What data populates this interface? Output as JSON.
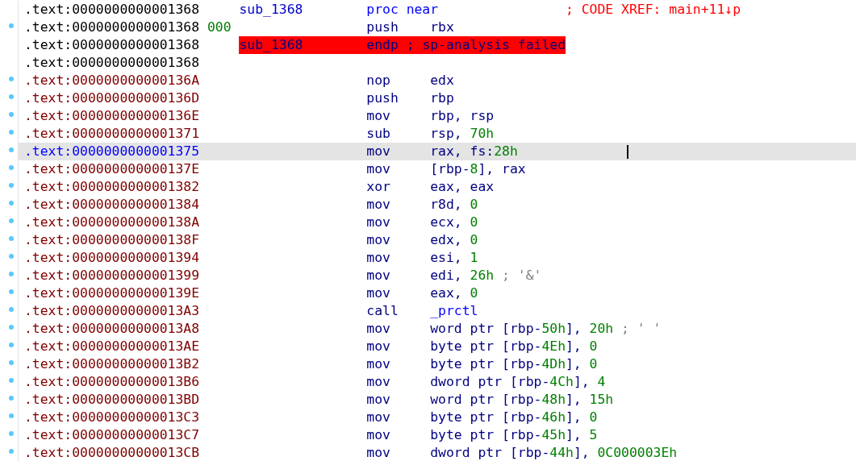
{
  "rows": [
    {
      "address": ".text:0000000000001368",
      "kind": "header",
      "dot": false,
      "selected": false,
      "error": false,
      "label": "sub_1368",
      "mnemonic": "proc near",
      "comment": {
        "text": "; CODE XREF: main+11↓p",
        "kind": "xref"
      }
    },
    {
      "address": ".text:0000000000001368",
      "kind": "header",
      "dot": true,
      "selected": false,
      "error": false,
      "stack": "000",
      "mnemonic": "push",
      "operands": [
        {
          "text": "rbx",
          "kind": "text"
        }
      ]
    },
    {
      "address": ".text:0000000000001368",
      "kind": "header",
      "dot": false,
      "selected": false,
      "error": true,
      "label": "sub_1368",
      "mnemonic": "endp",
      "comment": {
        "text": "; sp-analysis failed",
        "kind": "plain"
      }
    },
    {
      "address": ".text:0000000000001368",
      "kind": "header",
      "dot": false,
      "selected": false,
      "error": false
    },
    {
      "address": ".text:000000000000136A",
      "kind": "code",
      "dot": true,
      "selected": false,
      "error": false,
      "mnemonic": "nop",
      "operands": [
        {
          "text": "edx",
          "kind": "text"
        }
      ]
    },
    {
      "address": ".text:000000000000136D",
      "kind": "code",
      "dot": true,
      "selected": false,
      "error": false,
      "mnemonic": "push",
      "operands": [
        {
          "text": "rbp",
          "kind": "text"
        }
      ]
    },
    {
      "address": ".text:000000000000136E",
      "kind": "code",
      "dot": true,
      "selected": false,
      "error": false,
      "mnemonic": "mov",
      "operands": [
        {
          "text": "rbp, rsp",
          "kind": "text"
        }
      ]
    },
    {
      "address": ".text:0000000000001371",
      "kind": "code",
      "dot": true,
      "selected": false,
      "error": false,
      "mnemonic": "sub",
      "operands": [
        {
          "text": "rsp, ",
          "kind": "text"
        },
        {
          "text": "70h",
          "kind": "num"
        }
      ]
    },
    {
      "address": ".text:0000000000001375",
      "kind": "code",
      "dot": true,
      "selected": true,
      "error": false,
      "caret": true,
      "mnemonic": "mov",
      "operands": [
        {
          "text": "rax, fs:",
          "kind": "text"
        },
        {
          "text": "28h",
          "kind": "num"
        }
      ]
    },
    {
      "address": ".text:000000000000137E",
      "kind": "code",
      "dot": true,
      "selected": false,
      "error": false,
      "mnemonic": "mov",
      "operands": [
        {
          "text": "[rbp-",
          "kind": "text"
        },
        {
          "text": "8",
          "kind": "num"
        },
        {
          "text": "], rax",
          "kind": "text"
        }
      ]
    },
    {
      "address": ".text:0000000000001382",
      "kind": "code",
      "dot": true,
      "selected": false,
      "error": false,
      "mnemonic": "xor",
      "operands": [
        {
          "text": "eax, eax",
          "kind": "text"
        }
      ]
    },
    {
      "address": ".text:0000000000001384",
      "kind": "code",
      "dot": true,
      "selected": false,
      "error": false,
      "mnemonic": "mov",
      "operands": [
        {
          "text": "r8d, ",
          "kind": "text"
        },
        {
          "text": "0",
          "kind": "num"
        }
      ]
    },
    {
      "address": ".text:000000000000138A",
      "kind": "code",
      "dot": true,
      "selected": false,
      "error": false,
      "mnemonic": "mov",
      "operands": [
        {
          "text": "ecx, ",
          "kind": "text"
        },
        {
          "text": "0",
          "kind": "num"
        }
      ]
    },
    {
      "address": ".text:000000000000138F",
      "kind": "code",
      "dot": true,
      "selected": false,
      "error": false,
      "mnemonic": "mov",
      "operands": [
        {
          "text": "edx, ",
          "kind": "text"
        },
        {
          "text": "0",
          "kind": "num"
        }
      ]
    },
    {
      "address": ".text:0000000000001394",
      "kind": "code",
      "dot": true,
      "selected": false,
      "error": false,
      "mnemonic": "mov",
      "operands": [
        {
          "text": "esi, ",
          "kind": "text"
        },
        {
          "text": "1",
          "kind": "num"
        }
      ]
    },
    {
      "address": ".text:0000000000001399",
      "kind": "code",
      "dot": true,
      "selected": false,
      "error": false,
      "mnemonic": "mov",
      "operands": [
        {
          "text": "edi, ",
          "kind": "text"
        },
        {
          "text": "26h",
          "kind": "num"
        }
      ],
      "comment": {
        "text": "; '&'",
        "kind": "char"
      }
    },
    {
      "address": ".text:000000000000139E",
      "kind": "code",
      "dot": true,
      "selected": false,
      "error": false,
      "mnemonic": "mov",
      "operands": [
        {
          "text": "eax, ",
          "kind": "text"
        },
        {
          "text": "0",
          "kind": "num"
        }
      ]
    },
    {
      "address": ".text:00000000000013A3",
      "kind": "code",
      "dot": true,
      "selected": false,
      "error": false,
      "mnemonic": "call",
      "operands": [
        {
          "text": "_prctl",
          "kind": "name"
        }
      ]
    },
    {
      "address": ".text:00000000000013A8",
      "kind": "code",
      "dot": true,
      "selected": false,
      "error": false,
      "mnemonic": "mov",
      "operands": [
        {
          "text": "word ptr [rbp-",
          "kind": "text"
        },
        {
          "text": "50h",
          "kind": "num"
        },
        {
          "text": "], ",
          "kind": "text"
        },
        {
          "text": "20h",
          "kind": "num"
        }
      ],
      "comment": {
        "text": "; ' '",
        "kind": "char"
      }
    },
    {
      "address": ".text:00000000000013AE",
      "kind": "code",
      "dot": true,
      "selected": false,
      "error": false,
      "mnemonic": "mov",
      "operands": [
        {
          "text": "byte ptr [rbp-",
          "kind": "text"
        },
        {
          "text": "4Eh",
          "kind": "num"
        },
        {
          "text": "], ",
          "kind": "text"
        },
        {
          "text": "0",
          "kind": "num"
        }
      ]
    },
    {
      "address": ".text:00000000000013B2",
      "kind": "code",
      "dot": true,
      "selected": false,
      "error": false,
      "mnemonic": "mov",
      "operands": [
        {
          "text": "byte ptr [rbp-",
          "kind": "text"
        },
        {
          "text": "4Dh",
          "kind": "num"
        },
        {
          "text": "], ",
          "kind": "text"
        },
        {
          "text": "0",
          "kind": "num"
        }
      ]
    },
    {
      "address": ".text:00000000000013B6",
      "kind": "code",
      "dot": true,
      "selected": false,
      "error": false,
      "mnemonic": "mov",
      "operands": [
        {
          "text": "dword ptr [rbp-",
          "kind": "text"
        },
        {
          "text": "4Ch",
          "kind": "num"
        },
        {
          "text": "], ",
          "kind": "text"
        },
        {
          "text": "4",
          "kind": "num"
        }
      ]
    },
    {
      "address": ".text:00000000000013BD",
      "kind": "code",
      "dot": true,
      "selected": false,
      "error": false,
      "mnemonic": "mov",
      "operands": [
        {
          "text": "word ptr [rbp-",
          "kind": "text"
        },
        {
          "text": "48h",
          "kind": "num"
        },
        {
          "text": "], ",
          "kind": "text"
        },
        {
          "text": "15h",
          "kind": "num"
        }
      ]
    },
    {
      "address": ".text:00000000000013C3",
      "kind": "code",
      "dot": true,
      "selected": false,
      "error": false,
      "mnemonic": "mov",
      "operands": [
        {
          "text": "byte ptr [rbp-",
          "kind": "text"
        },
        {
          "text": "46h",
          "kind": "num"
        },
        {
          "text": "], ",
          "kind": "text"
        },
        {
          "text": "0",
          "kind": "num"
        }
      ]
    },
    {
      "address": ".text:00000000000013C7",
      "kind": "code",
      "dot": true,
      "selected": false,
      "error": false,
      "mnemonic": "mov",
      "operands": [
        {
          "text": "byte ptr [rbp-",
          "kind": "text"
        },
        {
          "text": "45h",
          "kind": "num"
        },
        {
          "text": "], ",
          "kind": "text"
        },
        {
          "text": "5",
          "kind": "num"
        }
      ]
    },
    {
      "address": ".text:00000000000013CB",
      "kind": "code",
      "dot": true,
      "selected": false,
      "error": false,
      "mnemonic": "mov",
      "operands": [
        {
          "text": "dword ptr [rbp-",
          "kind": "text"
        },
        {
          "text": "44h",
          "kind": "num"
        },
        {
          "text": "], ",
          "kind": "text"
        },
        {
          "text": "0C000003Eh",
          "kind": "num"
        }
      ]
    }
  ]
}
